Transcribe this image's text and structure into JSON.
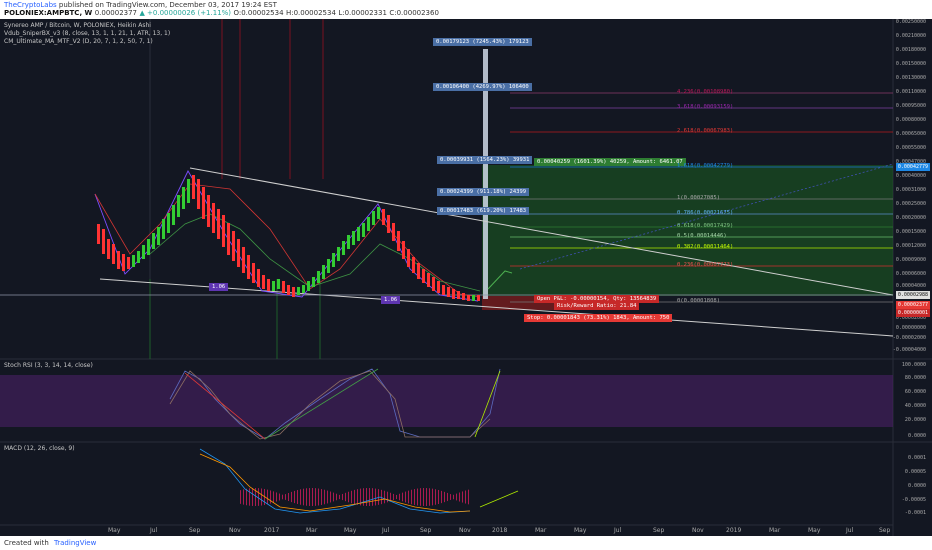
{
  "header": {
    "author": "TheCryptoLabs",
    "published_text": "published on TradingView.com, December 03, 2017 19:24 EST",
    "symbol": "POLONIEX:AMPBTC, W",
    "last": "0.00002377",
    "change": "▲ +0.00000026 (+1.11%)",
    "open": "O:0.00002534",
    "high": "H:0.00002534",
    "low": "L:0.00002331",
    "close": "C:0.00002360"
  },
  "legends": {
    "main": "Synereo AMP / Bitcoin, W, POLONIEX, Heikin Ashi",
    "ind1": "Vdub_SniperBX_v3 (8, close, 13, 1, 1, 21, 1, ATR, 13, 1)",
    "ind2": "CM_Ultimate_MA_MTF_V2 (D, 20, 7, 1, 2, 50, 7, 1)",
    "stoch": "Stoch RSI (3, 3, 14, 14, close)",
    "macd": "MACD (12, 26, close, 9)"
  },
  "price_axis": [
    "0.00250000",
    "0.00210000",
    "0.00180000",
    "0.00150000",
    "0.00130000",
    "0.00110000",
    "0.00095000",
    "0.00080000",
    "0.00065000",
    "0.00055000",
    "0.00047000",
    "0.00040000",
    "0.00031000",
    "0.00025000",
    "0.00020000",
    "0.00015000",
    "0.00012000",
    "0.00009000",
    "0.00006000",
    "0.00004000",
    "0.00002000",
    "0.00000000",
    "-0.00002000",
    "-0.00004000"
  ],
  "axis_badges": {
    "fib_top": "0.00042779",
    "price1": "0.00002988",
    "price2": "0.00002377",
    "price3": "0.00000001"
  },
  "stoch_axis": [
    "100.0000",
    "80.0000",
    "60.0000",
    "40.0000",
    "20.0000",
    "0.0000"
  ],
  "macd_axis": [
    "0.0001",
    "0.00005",
    "0.0000",
    "-0.00005",
    "-0.0001"
  ],
  "time_axis": [
    "May",
    "Jul",
    "Sep",
    "Nov",
    "2017",
    "Mar",
    "May",
    "Jul",
    "Sep",
    "Nov",
    "2018",
    "Mar",
    "May",
    "Jul",
    "Sep",
    "Nov",
    "2019",
    "Mar",
    "May",
    "Jul",
    "Sep"
  ],
  "targets": [
    "0.00179123 (7245.43%) 179123",
    "0.00106400 (4269.97%) 106400",
    "0.00039931 (1564.23%) 39931",
    "0.00024399 (911.18%) 24399",
    "0.00017483 (619.20%) 17483"
  ],
  "trade": {
    "target": "0.00040259 (1601.39%) 40259, Amount: 6461.07",
    "open_pl": "Open P&L: -0.00000154, Qty: 13564839",
    "rr": "Risk/Reward Ratio: 21.84",
    "stop": "Stop: 0.00001843 (73.31%) 1843, Amount: 750"
  },
  "fibs": [
    "4.236(0.00108980)",
    "3.618(0.00093159)",
    "2.618(0.00067983)",
    "1.618(0.00042779)",
    "1(0.00027085)",
    "0.786(0.00021675)",
    "0.618(0.00017429)",
    "0.5(0.00014446)",
    "0.382(0.00011464)",
    "0.236(0.00007773)",
    "0(0.00001808)"
  ],
  "labels": {
    "left_tag": "1.06",
    "right_tag": "1.06"
  },
  "footer": {
    "created_with": "Created with",
    "brand": "TradingView"
  }
}
